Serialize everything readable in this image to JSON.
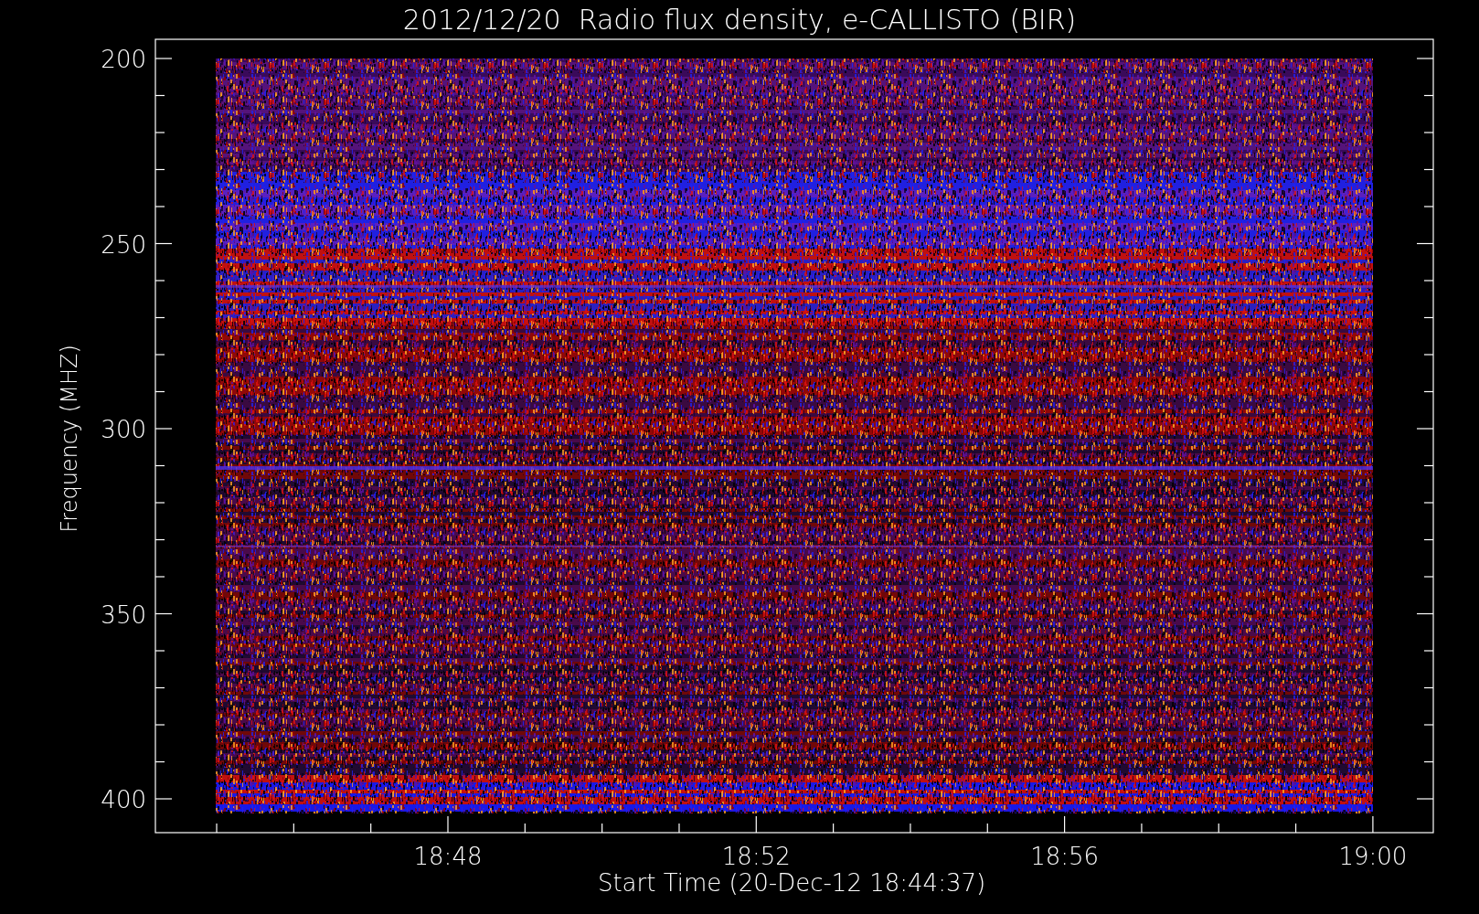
{
  "title": "2012/12/20  Radio flux density, e-CALLISTO (BIR)",
  "y_axis": {
    "label": "Frequency (MHZ)",
    "ticks": [
      "200",
      "250",
      "300",
      "350",
      "400"
    ]
  },
  "x_axis": {
    "label": "Start Time (20-Dec-12 18:44:37)",
    "ticks": [
      "18:48",
      "18:52",
      "18:56",
      "19:00"
    ]
  }
}
